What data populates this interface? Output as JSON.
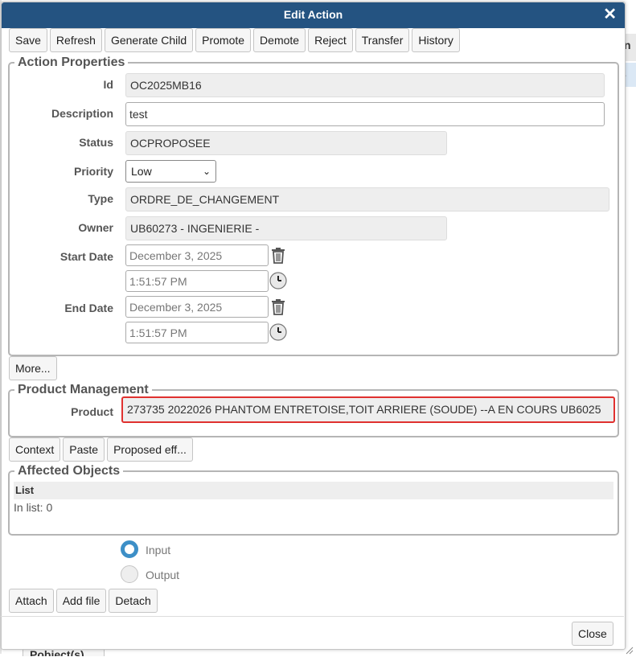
{
  "dialog": {
    "title": "Edit Action",
    "close_icon": "close-x-icon"
  },
  "toolbar": {
    "buttons": [
      "Save",
      "Refresh",
      "Generate Child",
      "Promote",
      "Demote",
      "Reject",
      "Transfer",
      "History"
    ]
  },
  "action_properties": {
    "legend": "Action Properties",
    "id_label": "Id",
    "id_value": "OC2025MB16",
    "description_label": "Description",
    "description_value": "test",
    "status_label": "Status",
    "status_value": "OCPROPOSEE",
    "priority_label": "Priority",
    "priority_value": "Low",
    "type_label": "Type",
    "type_value": "ORDRE_DE_CHANGEMENT",
    "owner_label": "Owner",
    "owner_value": "UB60273 - INGENIERIE -",
    "start_date_label": "Start Date",
    "start_date_value": "December 3, 2025",
    "start_time_value": "1:51:57 PM",
    "end_date_label": "End Date",
    "end_date_value": "December 3, 2025",
    "end_time_value": "1:51:57 PM"
  },
  "more_button": "More...",
  "product_management": {
    "legend": "Product Management",
    "product_label": "Product",
    "product_value": "273735 2022026 PHANTOM ENTRETOISE,TOIT ARRIERE (SOUDE) --A EN COURS UB6025",
    "highlight_color": "#e0312f"
  },
  "product_buttons": [
    "Context",
    "Paste",
    "Proposed eff..."
  ],
  "affected_objects": {
    "legend": "Affected Objects",
    "list_header": "List",
    "count_text": "In list: 0"
  },
  "direction": {
    "input_label": "Input",
    "output_label": "Output",
    "selected": "Input"
  },
  "object_buttons": [
    "Attach",
    "Add file",
    "Detach"
  ],
  "footer": {
    "close_label": "Close"
  },
  "background": {
    "tab_label": "Pobject(s)",
    "col_fragment": "n",
    "row_fragment": "."
  },
  "colors": {
    "title_bar": "#245381",
    "radio_accent": "#3d8fc7"
  }
}
